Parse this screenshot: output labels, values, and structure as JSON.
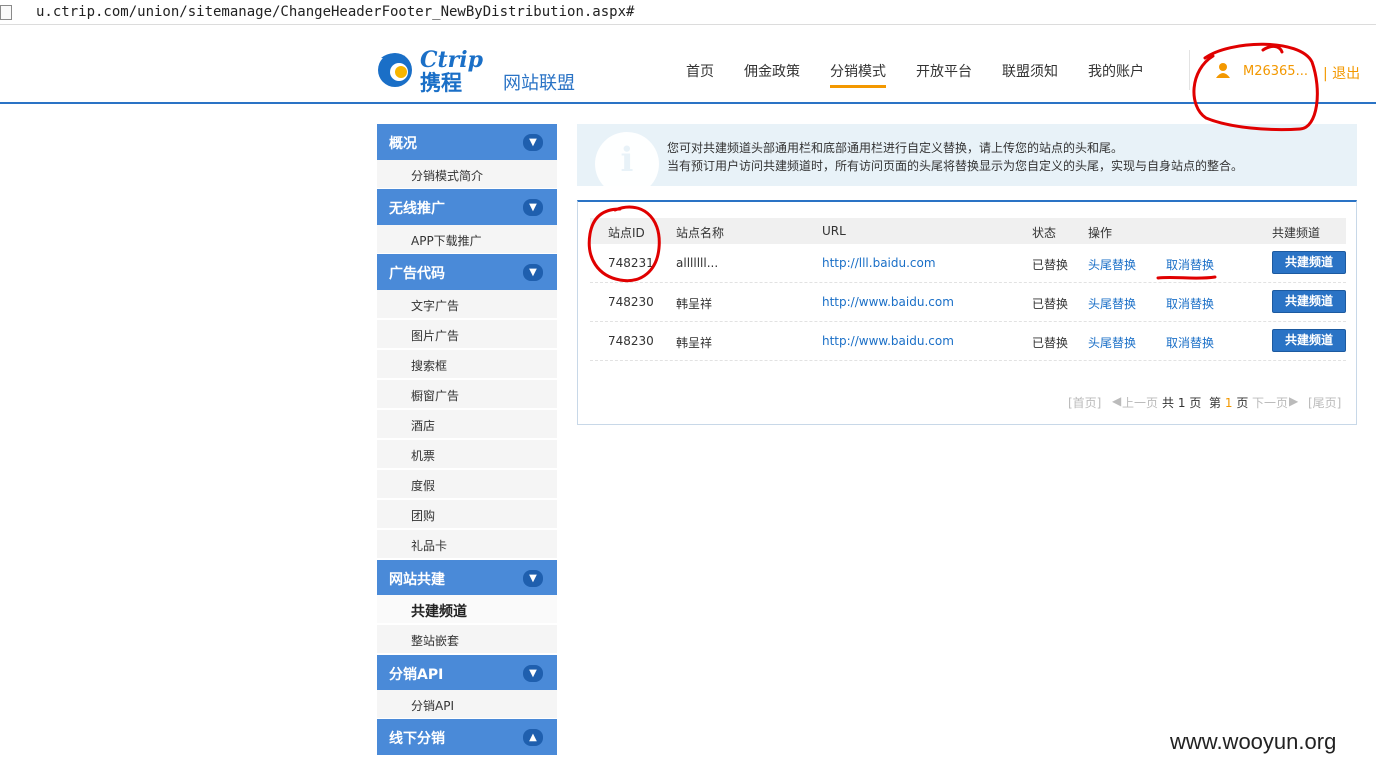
{
  "browser": {
    "url": "u.ctrip.com/union/sitemanage/ChangeHeaderFooter_NewByDistribution.aspx#"
  },
  "header": {
    "logo_word": "Ctrip",
    "logo_cn": "携程",
    "union_label": "网站联盟",
    "nav": [
      {
        "label": "首页"
      },
      {
        "label": "佣金政策"
      },
      {
        "label": "分销模式",
        "active": true
      },
      {
        "label": "开放平台"
      },
      {
        "label": "联盟须知"
      },
      {
        "label": "我的账户"
      }
    ],
    "user_name": "M26365...",
    "logout": "| 退出",
    "accent_color": "#f39800",
    "brand_color": "#2a73c5"
  },
  "sidebar": {
    "groups": [
      {
        "title": "概况",
        "toggle": "chevron-down",
        "items": [
          "分销模式简介"
        ]
      },
      {
        "title": "无线推广",
        "toggle": "chevron-down",
        "items": [
          "APP下载推广"
        ]
      },
      {
        "title": "广告代码",
        "toggle": "chevron-down",
        "items": [
          "文字广告",
          "图片广告",
          "搜索框",
          "橱窗广告",
          "酒店",
          "机票",
          "度假",
          "团购",
          "礼品卡"
        ]
      },
      {
        "title": "网站共建",
        "toggle": "chevron-down",
        "items": [
          "共建频道",
          "整站嵌套"
        ],
        "current": "共建频道"
      },
      {
        "title": "分销API",
        "toggle": "chevron-down",
        "items": [
          "分销API"
        ]
      },
      {
        "title": "线下分销",
        "toggle": "chevron-up",
        "items": []
      }
    ]
  },
  "notice": {
    "line1": "您可对共建频道头部通用栏和底部通用栏进行自定义替换，请上传您的站点的头和尾。",
    "line2": "当有预订用户访问共建频道时，所有访问页面的头尾将替换显示为您自定义的头尾，实现与自身站点的整合。"
  },
  "table": {
    "columns": [
      "站点ID",
      "站点名称",
      "URL",
      "状态",
      "操作",
      "共建频道"
    ],
    "rows": [
      {
        "id": "748231",
        "name": "alllllll...",
        "url": "http://lll.baidu.com",
        "status": "已替换",
        "op1": "头尾替换",
        "op2": "取消替换",
        "btn": "共建频道"
      },
      {
        "id": "748230",
        "name": "韩呈祥",
        "url": "http://www.baidu.com",
        "status": "已替换",
        "op1": "头尾替换",
        "op2": "取消替换",
        "btn": "共建频道"
      },
      {
        "id": "748230",
        "name": "韩呈祥",
        "url": "http://www.baidu.com",
        "status": "已替换",
        "op1": "头尾替换",
        "op2": "取消替换",
        "btn": "共建频道"
      }
    ]
  },
  "pagination": {
    "first": "[首页]",
    "prev": "上一页",
    "total_prefix": "共",
    "total": "1",
    "total_suffix": "页",
    "cur_prefix": "第",
    "current": "1",
    "cur_suffix": "页",
    "next": "下一页",
    "last": "[尾页]"
  },
  "watermark": "www.wooyun.org"
}
